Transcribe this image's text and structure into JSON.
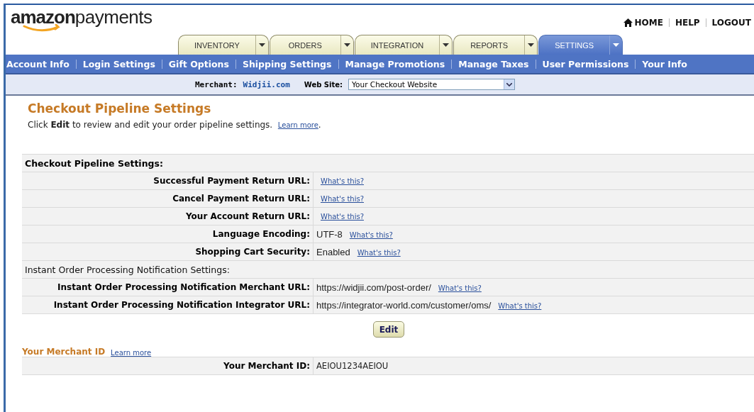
{
  "logo": {
    "bold": "amazon",
    "light": "payments"
  },
  "top_links": [
    {
      "label": "HOME",
      "kind": "home"
    },
    {
      "label": "HELP",
      "kind": "plain"
    },
    {
      "label": "LOGOUT",
      "kind": "plain"
    }
  ],
  "tabs": [
    {
      "label": "INVENTORY",
      "selected": false
    },
    {
      "label": "ORDERS",
      "selected": false
    },
    {
      "label": "INTEGRATION",
      "selected": false
    },
    {
      "label": "REPORTS",
      "selected": false
    },
    {
      "label": "SETTINGS",
      "selected": true
    }
  ],
  "subnav": [
    "Account Info",
    "Login Settings",
    "Gift Options",
    "Shipping Settings",
    "Manage Promotions",
    "Manage Taxes",
    "User Permissions",
    "Your Info"
  ],
  "merchant_bar": {
    "merchant_label": "Merchant:",
    "merchant": "Widjii.com",
    "website_label": "Web Site:",
    "website": "Your Checkout Website"
  },
  "page_title": "Checkout Pipeline Settings",
  "intro": {
    "text": "Click **Edit** to review and edit your order pipeline settings.",
    "link": "Learn more",
    "after": "."
  },
  "settings_table": {
    "heading": "Checkout Pipeline Settings:",
    "rows": [
      {
        "kind": "field",
        "label": "Successful Payment Return URL:",
        "link": "What's this?"
      },
      {
        "kind": "field",
        "label": "Cancel Payment Return URL:",
        "link": "What's this?"
      },
      {
        "kind": "field",
        "label": "Your Account Return URL:",
        "link": "What's this?"
      },
      {
        "kind": "field",
        "label": "Language Encoding:",
        "value": "UTF-8",
        "link": "What's this?"
      },
      {
        "kind": "field",
        "label": "Shopping Cart Security:",
        "value": "Enabled",
        "link": "What's this?"
      },
      {
        "kind": "subheading",
        "label": "Instant Order Processing Notification Settings:"
      },
      {
        "kind": "field",
        "label": "Instant Order Processing Notification Merchant URL:",
        "value": "https://widjii.com/post-order/",
        "link": "What's this?"
      },
      {
        "kind": "field",
        "label": "Instant Order Processing Notification Integrator URL:",
        "value": "https://integrator-world.com/customer/oms/",
        "link": "What's this?"
      }
    ]
  },
  "edit_button": "Edit",
  "merchant_id": {
    "title": "Your Merchant ID",
    "link": "Learn more",
    "label": "Your Merchant ID:",
    "value": "AEIOU1234AEIOU"
  }
}
